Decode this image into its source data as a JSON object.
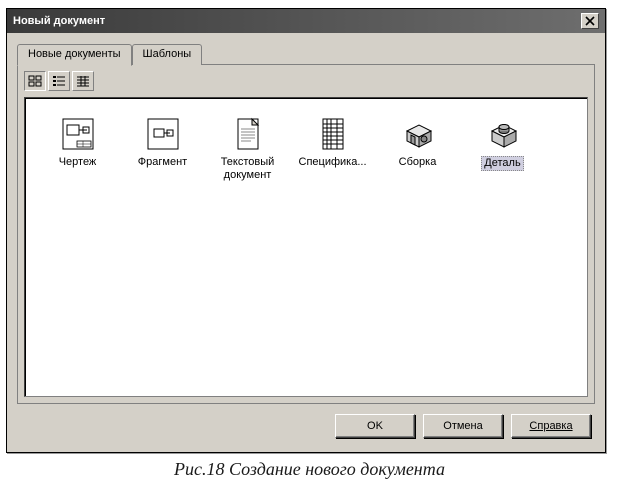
{
  "window": {
    "title": "Новый документ"
  },
  "tabs": [
    {
      "label": "Новые документы",
      "active": true
    },
    {
      "label": "Шаблоны",
      "active": false
    }
  ],
  "view_modes": [
    {
      "name": "large-icons",
      "pressed": true
    },
    {
      "name": "list",
      "pressed": false
    },
    {
      "name": "details",
      "pressed": false
    }
  ],
  "items": [
    {
      "label": "Чертеж",
      "icon": "drawing",
      "selected": false
    },
    {
      "label": "Фрагмент",
      "icon": "fragment",
      "selected": false
    },
    {
      "label": "Текстовый документ",
      "icon": "textdoc",
      "selected": false
    },
    {
      "label": "Специфика...",
      "icon": "spec",
      "selected": false
    },
    {
      "label": "Сборка",
      "icon": "assembly",
      "selected": false
    },
    {
      "label": "Деталь",
      "icon": "part",
      "selected": true
    }
  ],
  "buttons": {
    "ok": "OK",
    "cancel": "Отмена",
    "help": "Справка"
  },
  "caption": "Рис.18 Создание нового документа"
}
